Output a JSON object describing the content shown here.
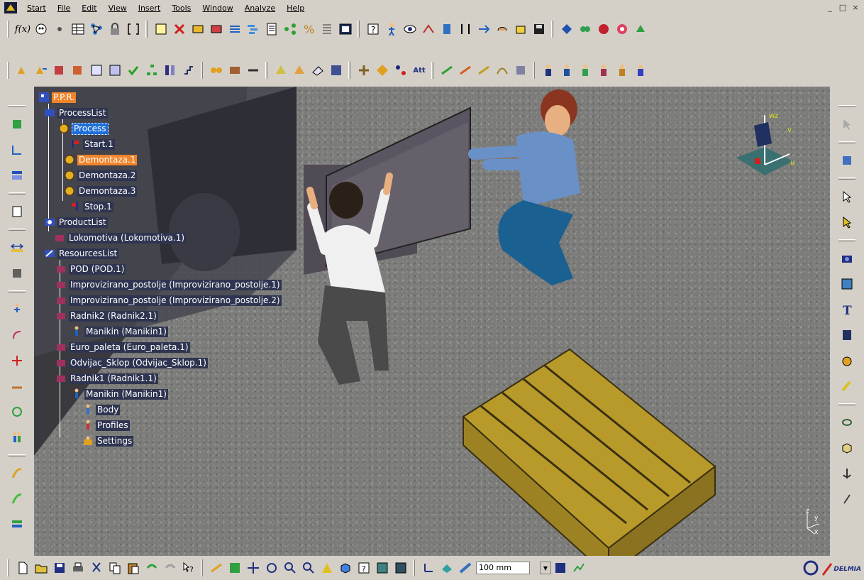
{
  "menu": {
    "items": [
      "Start",
      "File",
      "Edit",
      "View",
      "Insert",
      "Tools",
      "Window",
      "Analyze",
      "Help"
    ],
    "window_controls": [
      "_",
      "□",
      "×"
    ]
  },
  "tree": {
    "root": "P.P.R.",
    "process_list": "ProcessList",
    "process": "Process",
    "process_children": [
      "Start.1",
      "Demontaza.1",
      "Demontaza.2",
      "Demontaza.3",
      "Stop.1"
    ],
    "product_list": "ProductList",
    "products": [
      "Lokomotiva (Lokomotiva.1)"
    ],
    "resources_list": "ResourcesList",
    "resources": [
      "POD (POD.1)",
      "Improvizirano_postolje (Improvizirano_postolje.1)",
      "Improvizirano_postolje (Improvizirano_postolje.2)",
      "Radnik2 (Radnik2.1)"
    ],
    "radnik2_child": "Manikin (Manikin1)",
    "resources2": [
      "Euro_paleta (Euro_paleta.1)",
      "Odvijac_Sklop (Odvijac_Sklop.1)",
      "Radnik1 (Radnik1.1)"
    ],
    "radnik1_child": "Manikin (Manikin1)",
    "manikin_children": [
      "Body",
      "Profiles",
      "Settings"
    ]
  },
  "toolbar": {
    "fx_label": "f(x)",
    "att_label": "Att",
    "units_value": "100 mm"
  },
  "compass": {
    "labels": [
      "w",
      "z",
      "v",
      "u"
    ]
  },
  "axis": {
    "labels": [
      "z",
      "y",
      "x"
    ]
  },
  "brand": {
    "name": "DELMIA"
  },
  "colors": {
    "selection_orange": "#f0842b",
    "tree_label_bg": "#2f3550",
    "selection_blue": "#1f6fd8"
  }
}
